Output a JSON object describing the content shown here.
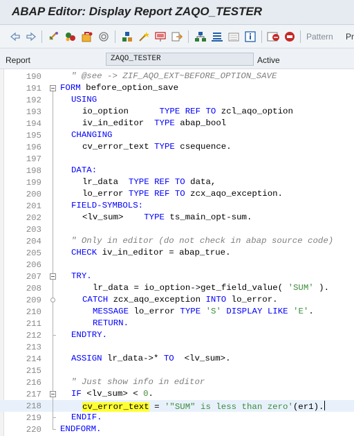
{
  "window": {
    "title": "ABAP Editor: Display Report ZAQO_TESTER"
  },
  "toolbar": {
    "icons": [
      "back-arrow-icon",
      "forward-arrow-icon",
      "other-object-icon",
      "check-icon",
      "activate-icon",
      "test-icon",
      "where-used-icon",
      "object-list-icon",
      "wizard-icon",
      "navigation-window-icon",
      "pattern-icon",
      "display-object-list-icon",
      "hierarchy-icon",
      "help-icon",
      "breakpoint-icon",
      "session-breakpoint-icon"
    ],
    "pattern_label": "Pattern",
    "pretty_printer_label": "Pr"
  },
  "header": {
    "report_label": "Report",
    "report_value": "ZAQO_TESTER",
    "status": "Active"
  },
  "editor": {
    "lines": [
      {
        "no": "190",
        "text": "\" @see -> ZIF_AQO_EXT~BEFORE_OPTION_SAVE"
      },
      {
        "no": "191",
        "text": "FORM before_option_save"
      },
      {
        "no": "192",
        "text": "USING"
      },
      {
        "no": "193",
        "text": "io_option      TYPE REF TO zcl_aqo_option"
      },
      {
        "no": "194",
        "text": "iv_in_editor  TYPE abap_bool"
      },
      {
        "no": "195",
        "text": "CHANGING"
      },
      {
        "no": "196",
        "text": "cv_error_text TYPE csequence."
      },
      {
        "no": "197",
        "text": ""
      },
      {
        "no": "198",
        "text": "DATA:"
      },
      {
        "no": "199",
        "text": "lr_data  TYPE REF TO data,"
      },
      {
        "no": "200",
        "text": "lo_error TYPE REF TO zcx_aqo_exception."
      },
      {
        "no": "201",
        "text": "FIELD-SYMBOLS:"
      },
      {
        "no": "202",
        "text": "<lv_sum>    TYPE ts_main_opt-sum."
      },
      {
        "no": "203",
        "text": ""
      },
      {
        "no": "204",
        "text": "\" Only in editor (do not check in abap source code)"
      },
      {
        "no": "205",
        "text": "CHECK iv_in_editor = abap_true."
      },
      {
        "no": "206",
        "text": ""
      },
      {
        "no": "207",
        "text": "TRY."
      },
      {
        "no": "208",
        "text": "lr_data = io_option->get_field_value( 'SUM' )."
      },
      {
        "no": "209",
        "text": "CATCH zcx_aqo_exception INTO lo_error."
      },
      {
        "no": "210",
        "text": "MESSAGE lo_error TYPE 'S' DISPLAY LIKE 'E'."
      },
      {
        "no": "211",
        "text": "RETURN."
      },
      {
        "no": "212",
        "text": "ENDTRY."
      },
      {
        "no": "213",
        "text": ""
      },
      {
        "no": "214",
        "text": "ASSIGN lr_data->* TO  <lv_sum>."
      },
      {
        "no": "215",
        "text": ""
      },
      {
        "no": "216",
        "text": "\" Just show info in editor"
      },
      {
        "no": "217",
        "text": "IF <lv_sum> < 0."
      },
      {
        "no": "218",
        "text": "cv_error_text = '\"SUM\" is less than zero'(er1)."
      },
      {
        "no": "219",
        "text": "ENDIF."
      },
      {
        "no": "220",
        "text": "ENDFORM."
      }
    ]
  }
}
